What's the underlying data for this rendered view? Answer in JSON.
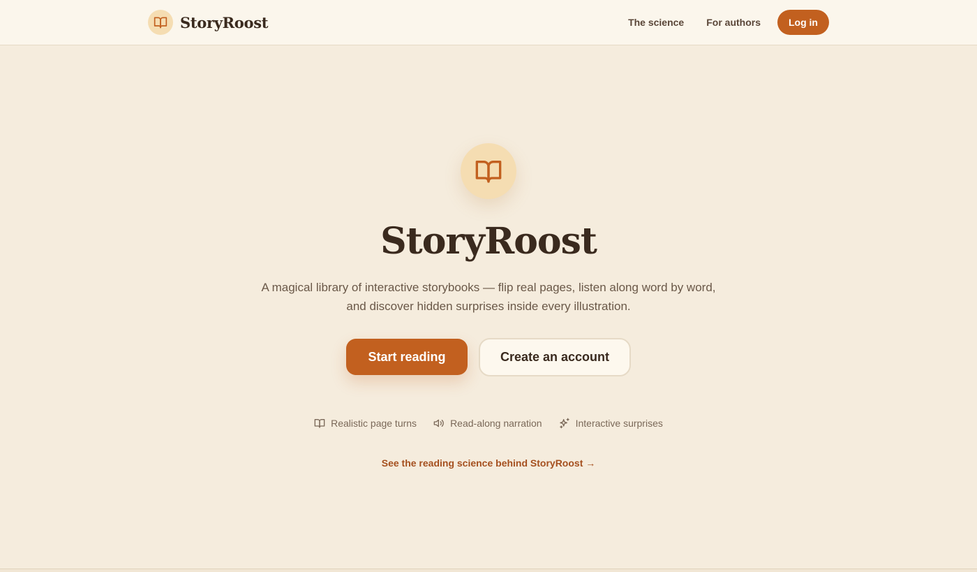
{
  "header": {
    "brand_name": "StoryRoost",
    "brand_icon": "open-book-icon",
    "nav": [
      {
        "label": "The science"
      },
      {
        "label": "For authors"
      }
    ],
    "login_label": "Log in"
  },
  "hero": {
    "icon": "open-book-icon",
    "title": "StoryRoost",
    "subtitle": "A magical library of interactive storybooks — flip real pages, listen along word by word, and discover hidden surprises inside every illustration.",
    "primary_cta": "Start reading",
    "secondary_cta": "Create an account",
    "features": [
      {
        "icon": "open-book-icon",
        "label": "Realistic page turns"
      },
      {
        "icon": "speaker-icon",
        "label": "Read-along narration"
      },
      {
        "icon": "sparkles-icon",
        "label": "Interactive surprises"
      }
    ],
    "science_link": "See the reading science behind StoryRoost →"
  },
  "colors": {
    "background": "#f5ecdd",
    "header_bg": "#fbf6ec",
    "accent": "#c2601f",
    "badge_bg": "#f5ddb2",
    "text_dark": "#3a2a1e",
    "link": "#a5501f"
  }
}
